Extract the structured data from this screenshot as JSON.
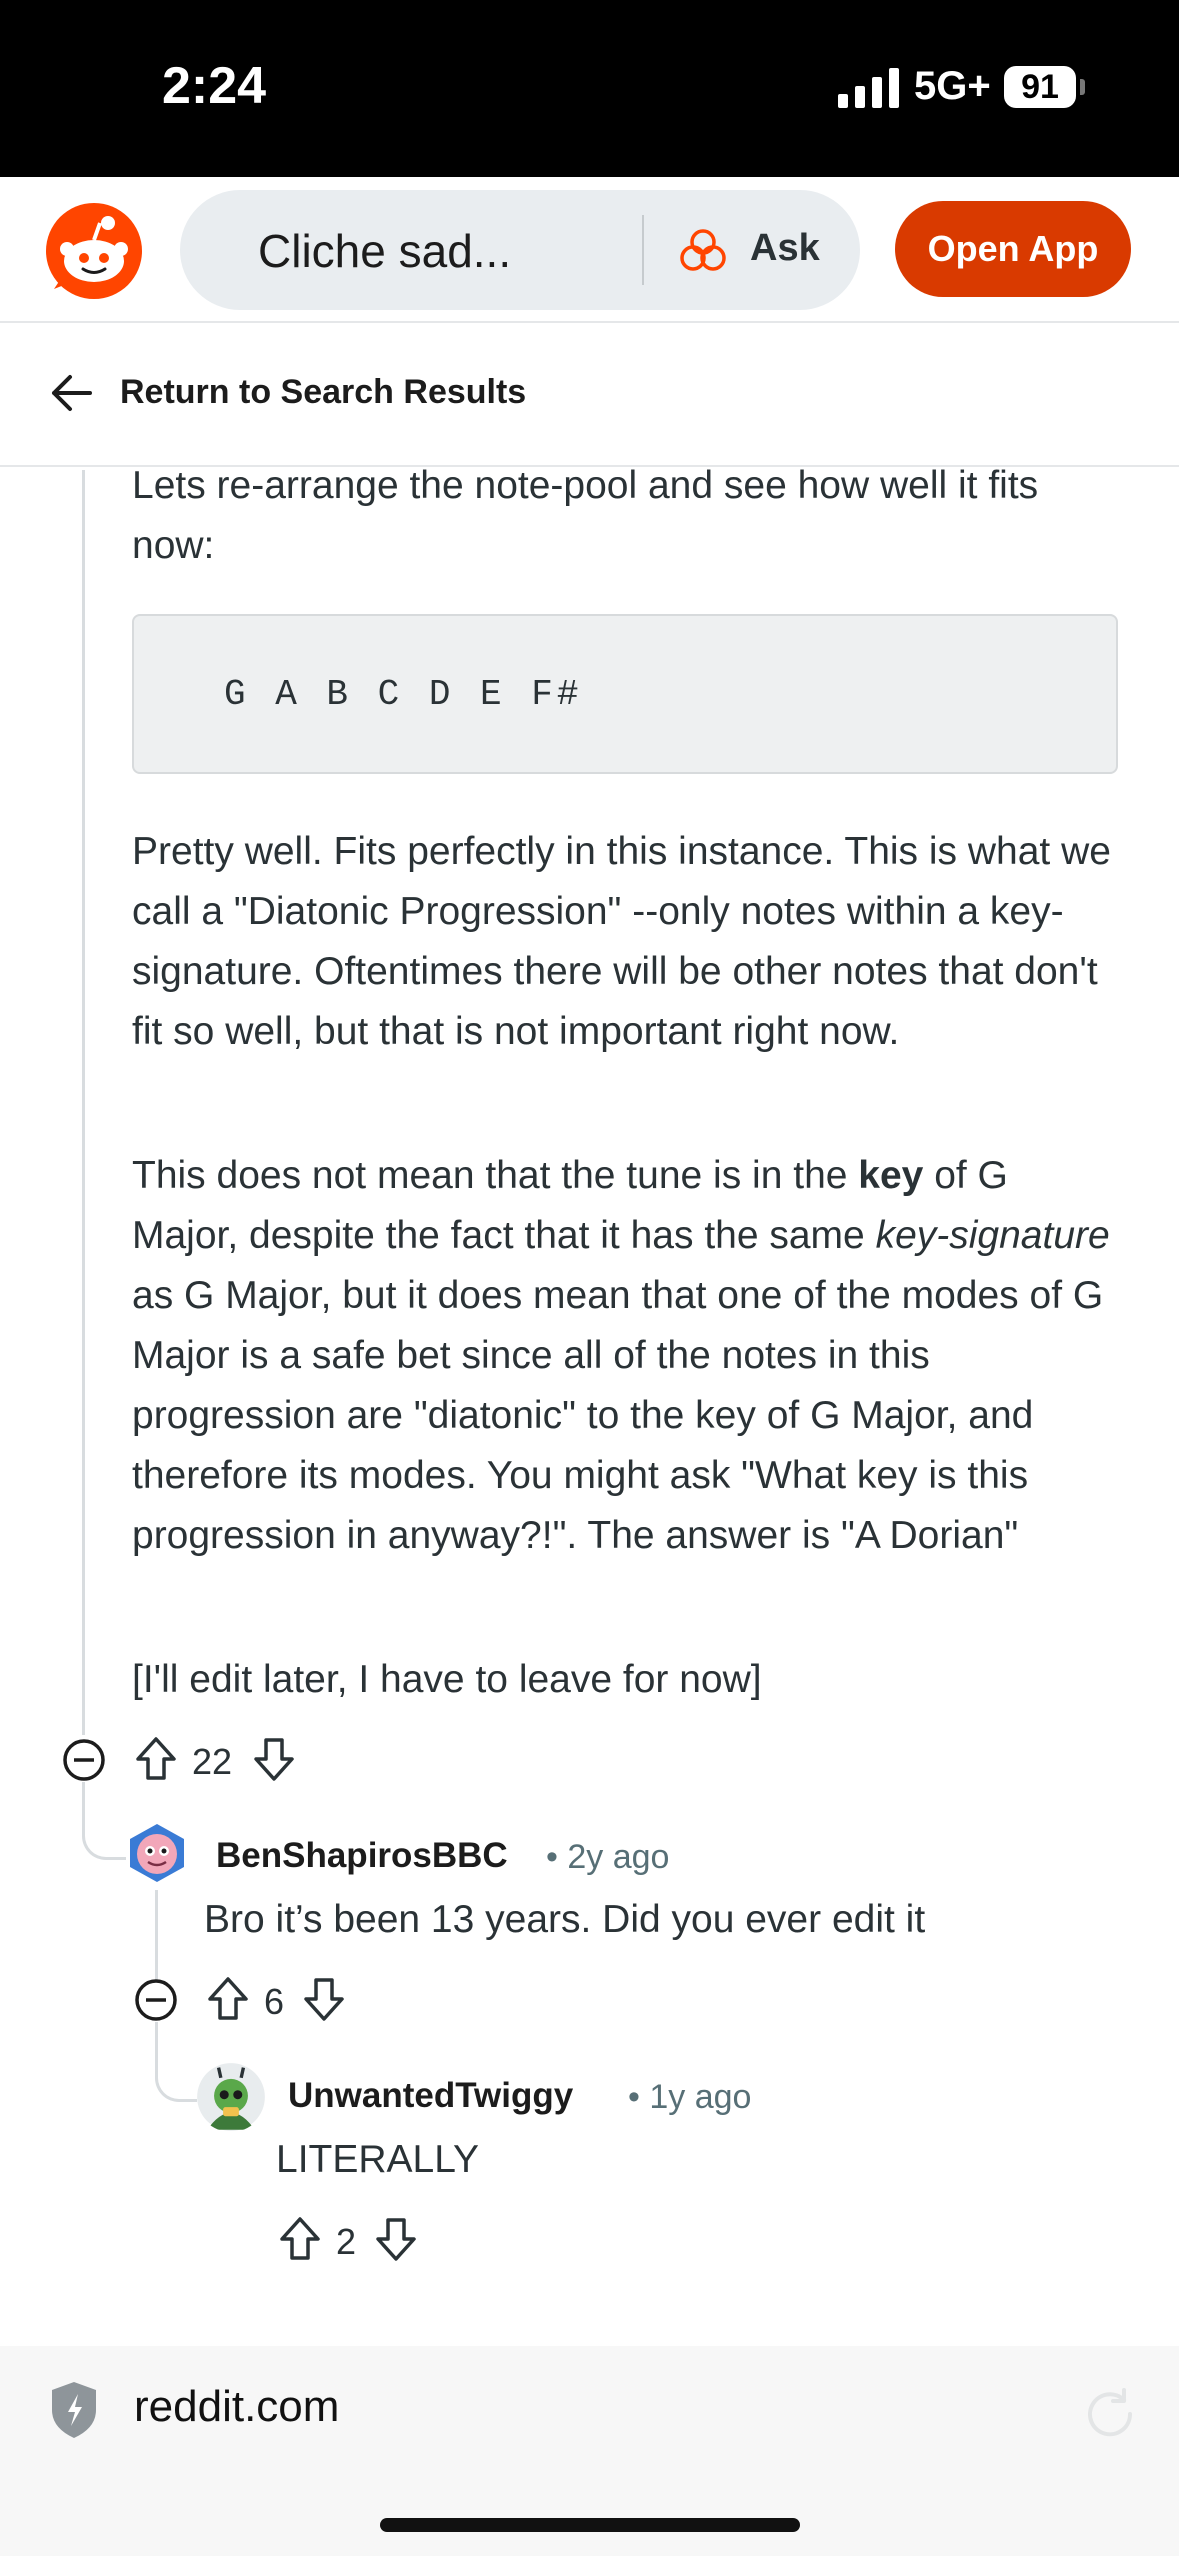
{
  "status_bar": {
    "time": "2:24",
    "network": "5G+",
    "battery": "91"
  },
  "header": {
    "search_text": "Cliche sad...",
    "ask_label": "Ask",
    "open_app_label": "Open App",
    "accent_color": "#d93a00"
  },
  "nav": {
    "back_label": "Return to Search Results"
  },
  "comment": {
    "intro": "Lets re-arrange the note-pool and see how well it fits now:",
    "code": "G A B C D E F#",
    "para1": "Pretty well. Fits perfectly in this instance. This is what we call a \"Diatonic Progression\" --only notes within a key-signature. Oftentimes there will be other notes that don't fit so well, but that is not important right now.",
    "para2_a": "This does not mean that the tune is in the ",
    "para2_key": "key",
    "para2_b": " of G Major, despite the fact that it has the same ",
    "para2_keysig": "key-signature",
    "para2_c": " as G Major, but it does mean that one of the modes of G Major is a safe bet since all of the notes in this progression are \"diatonic\" to the key of G Major, and therefore its modes. You might ask \"What key is this progression in anyway?!\". The answer is \"A Dorian\"",
    "para3": "[I'll edit later, I have to leave for now]",
    "votes": "22"
  },
  "replies": [
    {
      "author": "BenShapirosBBC",
      "age": "2y ago",
      "text": "Bro it’s been 13 years. Did you ever edit it",
      "votes": "6"
    },
    {
      "author": "UnwantedTwiggy",
      "age": "1y ago",
      "text": "LITERALLY",
      "votes": "2"
    }
  ],
  "browser": {
    "url": "reddit.com"
  }
}
